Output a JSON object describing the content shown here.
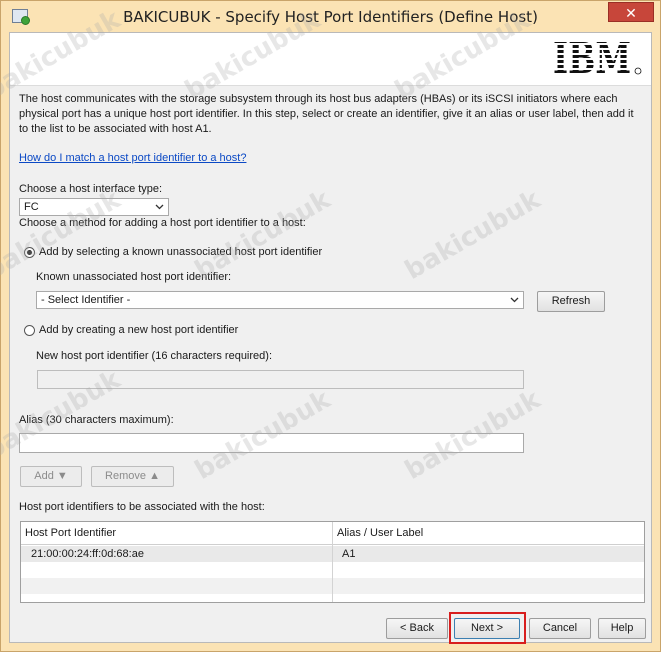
{
  "window": {
    "title": "BAKICUBUK - Specify Host Port Identifiers (Define Host)",
    "close_label": "✕"
  },
  "header": {
    "logo_text": "IBM"
  },
  "description": "The host communicates with the storage subsystem through its host bus adapters (HBAs) or its iSCSI initiators where each physical port has a unique host port identifier. In this step, select or create an identifier, give it an alias or user label, then add it to the list to be associated with host A1.",
  "help_link": "How do I match a host port identifier to a host?",
  "interface_type": {
    "label": "Choose a host interface type:",
    "value": "FC"
  },
  "method": {
    "label": "Choose a method for adding a host port identifier to a host:",
    "option_known": "Add by selecting a known unassociated host port identifier",
    "known_label": "Known unassociated host port identifier:",
    "known_value": "- Select Identifier -",
    "refresh_label": "Refresh",
    "option_new": "Add by creating a new host port identifier",
    "new_label": "New host port identifier (16 characters required):",
    "new_value": "",
    "selected": "known"
  },
  "alias": {
    "label": "Alias (30 characters maximum):",
    "value": ""
  },
  "buttons": {
    "add": "Add ▼",
    "remove": "Remove ▲"
  },
  "table": {
    "label": "Host port identifiers to be associated with the host:",
    "columns": [
      "Host Port Identifier",
      "Alias / User Label"
    ],
    "rows": [
      {
        "id": "21:00:00:24:ff:0d:68:ae",
        "alias": "A1"
      }
    ]
  },
  "footer": {
    "back": "< Back",
    "next": "Next >",
    "cancel": "Cancel",
    "help": "Help"
  },
  "watermark": "bakicubuk",
  "colors": {
    "titlebar": "#fbe3b4",
    "close": "#c7463a",
    "link": "#0b49c5",
    "highlight": "#d81e1e"
  }
}
